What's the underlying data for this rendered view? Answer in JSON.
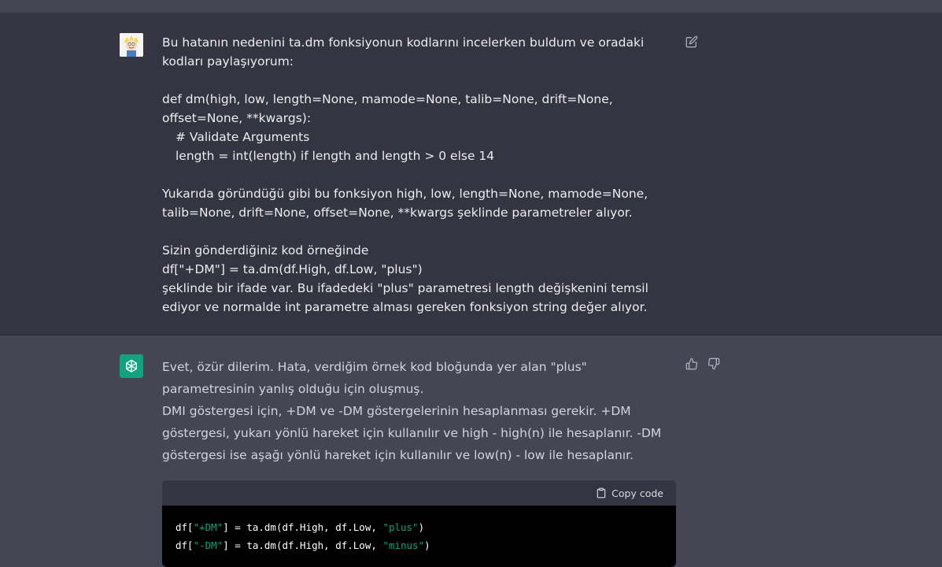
{
  "user_message": {
    "lines": [
      "Bu hatanın nedenini ta.dm fonksiyonun kodlarını incelerken buldum ve oradaki kodları paylaşıyorum:",
      "def dm(high, low, length=None, mamode=None, talib=None, drift=None, offset=None, **kwargs):",
      "# Validate Arguments",
      "length = int(length) if length and length > 0 else 14",
      "Yukarıda göründüğü gibi bu fonksiyon high, low, length=None, mamode=None, talib=None, drift=None, offset=None, **kwargs şeklinde parametreler alıyor.",
      "Sizin gönderdiğiniz kod örneğinde",
      "df[\"+DM\"] = ta.dm(df.High, df.Low, \"plus\")",
      "şeklinde bir ifade var. Bu ifadedeki \"plus\" parametresi length değişkenini temsil ediyor ve normalde int parametre alması gereken fonksiyon string değer alıyor."
    ],
    "edit_icon": "edit-icon"
  },
  "assistant_message": {
    "paragraphs": [
      "Evet, özür dilerim. Hata, verdiğim örnek kod bloğunda yer alan \"plus\" parametresinin yanlış olduğu için oluşmuş.",
      "DMI göstergesi için, +DM ve -DM göstergelerinin hesaplanması gerekir. +DM göstergesi, yukarı yönlü hareket için kullanılır ve high - high(n) ile hesaplanır. -DM göstergesi ise aşağı yönlü hareket için kullanılır ve low(n) - low ile hesaplanır."
    ],
    "copy_label": "Copy code",
    "code_lines": [
      {
        "pre": "df[",
        "str1": "\"+DM\"",
        "mid": "] = ta.dm(df.High, df.Low, ",
        "str2": "\"plus\"",
        "post": ")"
      },
      {
        "pre": "df[",
        "str1": "\"-DM\"",
        "mid": "] = ta.dm(df.High, df.Low, ",
        "str2": "\"minus\"",
        "post": ")"
      }
    ],
    "icons": [
      "thumbs-up-icon",
      "thumbs-down-icon",
      "clipboard-icon",
      "openai-logo-icon"
    ]
  },
  "colors": {
    "user_bg": "#343541",
    "assistant_bg": "#444654",
    "accent": "#10a37f",
    "code_string": "#00a67d"
  }
}
